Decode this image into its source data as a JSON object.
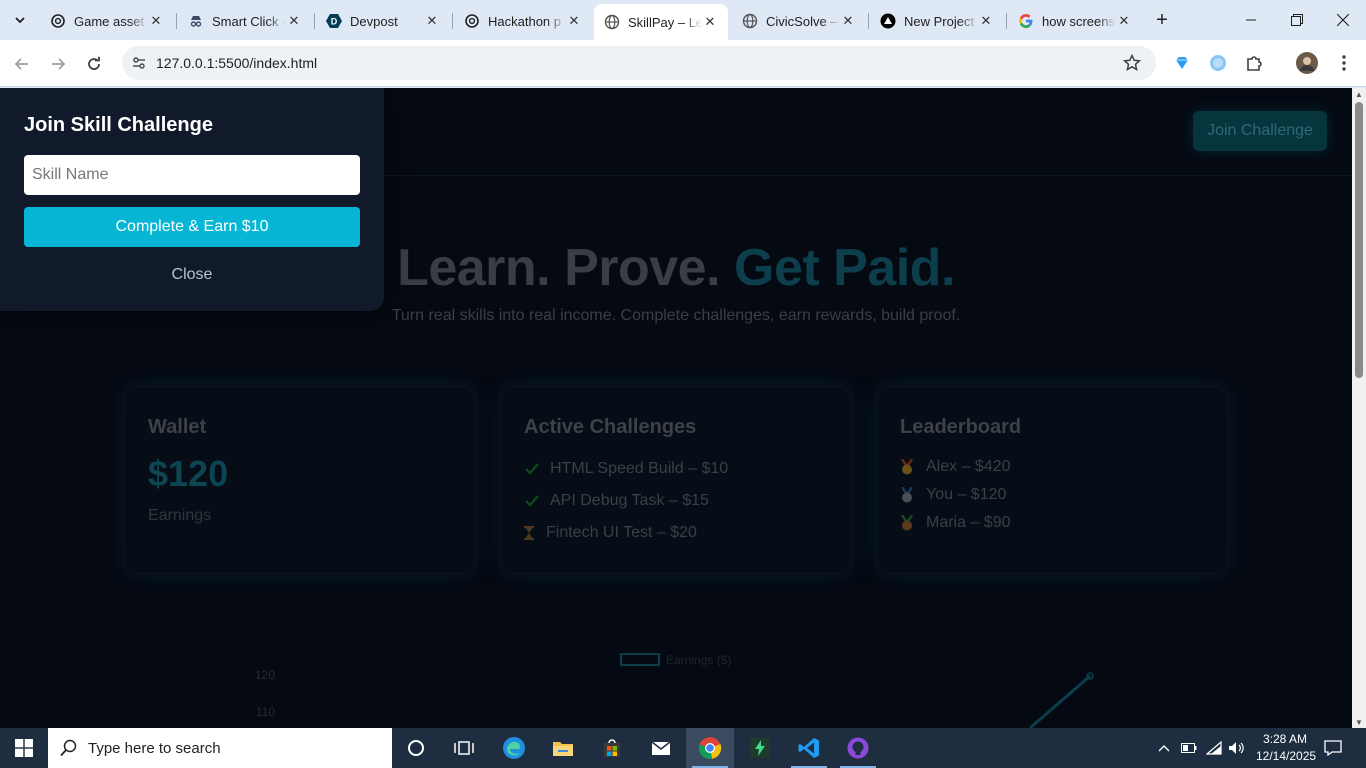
{
  "browser": {
    "tabs": [
      {
        "title": "Game asset c",
        "icon": "openai-icon"
      },
      {
        "title": "Smart Click -",
        "icon": "incognito-icon"
      },
      {
        "title": "Devpost",
        "icon": "devpost-icon"
      },
      {
        "title": "Hackathon p",
        "icon": "openai-icon"
      },
      {
        "title": "SkillPay – Le",
        "icon": "globe-icon",
        "active": true
      },
      {
        "title": "CivicSolve —",
        "icon": "globe-icon"
      },
      {
        "title": "New Project",
        "icon": "vercel-icon"
      },
      {
        "title": "how screens",
        "icon": "google-icon"
      }
    ],
    "url": "127.0.0.1:5500/index.html"
  },
  "page": {
    "header": {
      "join_label": "Join Challenge"
    },
    "hero": {
      "title_part": "Learn. Prove. ",
      "title_accent": "Get Paid.",
      "subtitle": "Turn real skills into real income. Complete challenges, earn rewards, build proof."
    },
    "wallet": {
      "title": "Wallet",
      "amount": "$120",
      "label": "Earnings"
    },
    "challenges": {
      "title": "Active Challenges",
      "items": [
        {
          "status": "done",
          "text": "HTML Speed Build – $10"
        },
        {
          "status": "done",
          "text": "API Debug Task – $15"
        },
        {
          "status": "pending",
          "text": "Fintech UI Test – $20"
        }
      ]
    },
    "leaderboard": {
      "title": "Leaderboard",
      "items": [
        {
          "medal": "gold",
          "text": "Alex – $420"
        },
        {
          "medal": "silver",
          "text": "You – $120"
        },
        {
          "medal": "bronze",
          "text": "Maria – $90"
        }
      ]
    },
    "chart": {
      "legend": "Earnings ($)",
      "yticks": [
        "120",
        "110"
      ]
    }
  },
  "modal": {
    "title": "Join Skill Challenge",
    "input_placeholder": "Skill Name",
    "submit_label": "Complete & Earn $10",
    "close_label": "Close"
  },
  "taskbar": {
    "search_placeholder": "Type here to search",
    "time": "3:28 AM",
    "date": "12/14/2025"
  },
  "colors": {
    "accent": "#06b6d4",
    "page_bg": "#050912",
    "modal_bg": "#111a2b"
  }
}
